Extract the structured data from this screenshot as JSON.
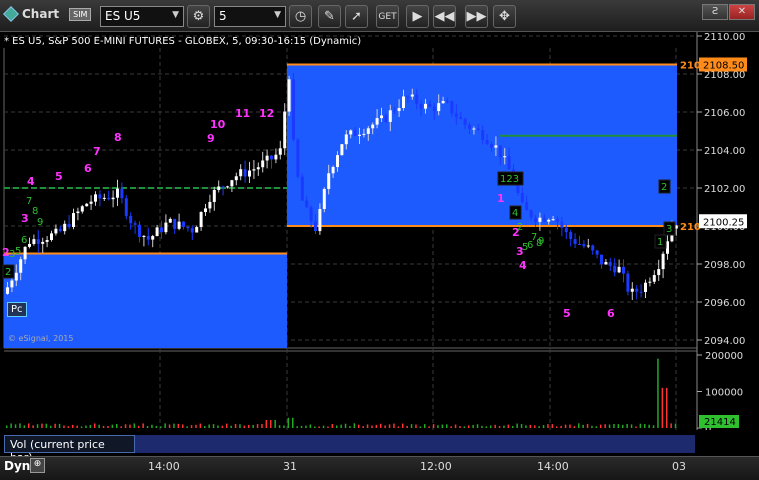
{
  "toolbar": {
    "app_title": "Chart",
    "sim_badge": "SIM",
    "symbol": "ES U5",
    "interval": "5",
    "icons": [
      "gear-icon",
      "clock-icon",
      "pencil-icon",
      "cursor-icon",
      "get-icon",
      "play-icon",
      "rewind-icon",
      "forward-icon",
      "grab-icon"
    ],
    "win_restore_label": "Ƨ",
    "win_close_label": "✕"
  },
  "chart": {
    "info_line": "* ES U5, S&P 500 E-MINI FUTURES - GLOBEX, 5, 09:30-16:15 (Dynamic)",
    "credit": "© eSignal, 2015",
    "pc_label": "Pc",
    "price_ticks": [
      "2110.00",
      "2108.00",
      "2106.00",
      "2104.00",
      "2102.00",
      "2100.00",
      "2098.00",
      "2096.00",
      "2094.00"
    ],
    "upper_level_label": "2108.50",
    "upper_level_prefix": "210",
    "last_price_label": "2100.25",
    "last_price_prefix": "210",
    "colors": {
      "up_candle": "#ffffff",
      "down_candle": "#1a3aff",
      "box_fill": "#1e5bff",
      "level_orange": "#ff8c1a",
      "level_green": "#1e8f3a",
      "magenta": "#ff33ff",
      "count_green": "#2fbf2f"
    },
    "annotations_magenta": [
      "2",
      "3",
      "4",
      "5",
      "6",
      "7",
      "8",
      "9",
      "10",
      "11",
      "12",
      "1",
      "2",
      "3",
      "4",
      "5",
      "6"
    ],
    "annotations_green": [
      "7",
      "8",
      "9",
      "6",
      "5",
      "3",
      "2",
      "5",
      "6",
      "7",
      "8",
      "9"
    ],
    "count_boxes": [
      "2",
      "123",
      "4",
      "2",
      "3",
      "1"
    ]
  },
  "volume": {
    "ticks": [
      "200000",
      "100000",
      "0"
    ],
    "last_label": "21414",
    "panel_label": "Vol (current price bar)"
  },
  "time_axis": {
    "dyn_label": "Dyn",
    "zoom_label": "⊕",
    "labels": [
      "14:00",
      "31",
      "12:00",
      "14:00",
      "03"
    ]
  }
}
